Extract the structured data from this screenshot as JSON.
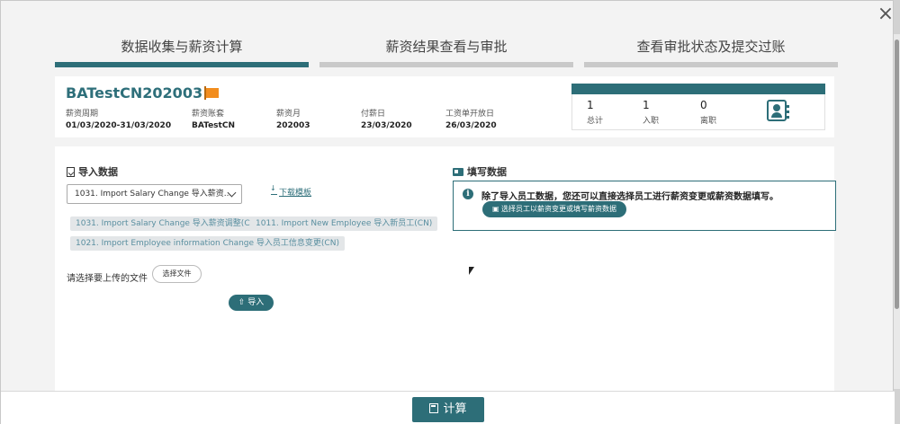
{
  "close_label": "×",
  "steps": [
    {
      "label": "数据收集与薪资计算",
      "active": true
    },
    {
      "label": "薪资结果查看与审批",
      "active": false
    },
    {
      "label": "查看审批状态及提交过账",
      "active": false
    }
  ],
  "period": {
    "name": "BATestCN202003",
    "fields": [
      {
        "label": "薪资周期",
        "value": "01/03/2020-31/03/2020"
      },
      {
        "label": "薪资账套",
        "value": "BATestCN"
      },
      {
        "label": "薪资月",
        "value": "202003"
      },
      {
        "label": "付薪日",
        "value": "23/03/2020"
      },
      {
        "label": "工资单开放日",
        "value": "26/03/2020"
      }
    ]
  },
  "stats": [
    {
      "value": "1",
      "label": "总计"
    },
    {
      "value": "1",
      "label": "入职"
    },
    {
      "value": "0",
      "label": "离职"
    }
  ],
  "import_section": {
    "title": "导入数据",
    "selected_template": "1031. Import Salary Change 导入薪资...",
    "download_link": "下载模板",
    "tags": [
      "1031. Import Salary Change 导入薪资调整(CN)",
      "1011. Import New Employee 导入新员工(CN)",
      "1021. Import Employee information Change 导入员工信息变更(CN)"
    ],
    "upload_label": "请选择要上传的文件",
    "choose_file": "选择文件",
    "import_button": "导入"
  },
  "fill_section": {
    "title": "填写数据",
    "notice": "除了导入员工数据，您还可以直接选择员工进行薪资变更或薪资数据填写。",
    "select_button": "选择员工以薪资变更或填写薪资数据"
  },
  "footer": {
    "calc_button": "计算"
  },
  "colors": {
    "primary": "#2d6e78",
    "accent_flag": "#f28d1e",
    "tag_bg": "#e3e6e8",
    "tag_text": "#5a8fa0"
  }
}
